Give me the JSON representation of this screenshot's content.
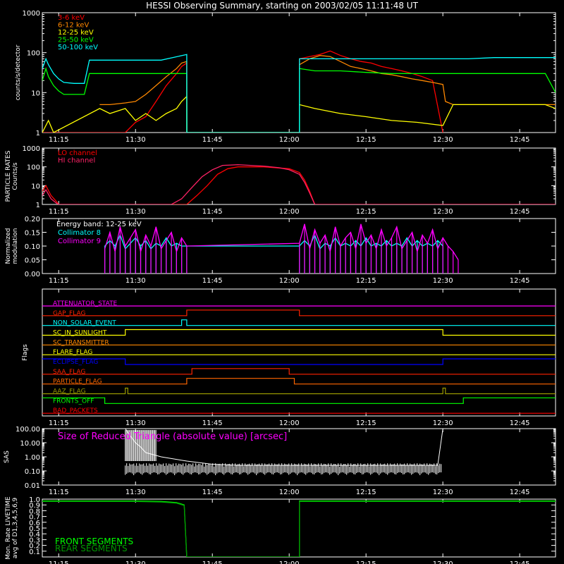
{
  "title": "HESSI Observing Summary, starting on 2003/02/05 11:11:48 UT",
  "time_axis": {
    "range_minutes": [
      "11:11:48",
      "12:53"
    ],
    "tick_labels": [
      "11:15",
      "11:30",
      "11:45",
      "12:00",
      "12:15",
      "12:30",
      "12:45"
    ],
    "tick_minutes": [
      675,
      690,
      705,
      720,
      735,
      750,
      765
    ]
  },
  "chart_data": [
    {
      "type": "line",
      "ylabel": "counts/s/detector",
      "yscale": "log",
      "ylim": [
        1,
        1000
      ],
      "ytick_labels": [
        "1",
        "10",
        "100",
        "1000"
      ],
      "ytick_values": [
        1,
        10,
        100,
        1000
      ],
      "legend": "top-left",
      "series": [
        {
          "name": "3-6 keV",
          "color": "#ff0000",
          "x": [
            671.8,
            673,
            674,
            675,
            677,
            680,
            682,
            684,
            688,
            690,
            692,
            694,
            696,
            698,
            699,
            700,
            700.01,
            722,
            722.01,
            724,
            726,
            728,
            730,
            732,
            734,
            736,
            738,
            740,
            742,
            744,
            746,
            748,
            750
          ],
          "y": [
            1,
            1,
            1,
            1,
            1,
            1,
            1,
            1,
            1,
            1.8,
            2.5,
            6,
            15,
            30,
            45,
            55,
            1,
            1,
            70,
            80,
            90,
            110,
            85,
            70,
            60,
            55,
            45,
            40,
            35,
            30,
            25,
            20,
            1
          ]
        },
        {
          "name": "6-12 keV",
          "color": "#ff8800",
          "x": [
            683,
            685,
            688,
            690,
            692,
            694,
            696,
            698,
            699,
            700,
            700.01,
            722,
            722.01,
            724,
            726,
            728,
            730,
            732,
            734,
            736,
            738,
            740,
            742,
            744,
            746,
            748,
            750,
            750.5,
            752,
            755,
            760,
            765,
            772
          ],
          "y": [
            5,
            5,
            5.5,
            6,
            9,
            15,
            25,
            40,
            55,
            60,
            1,
            1,
            50,
            70,
            85,
            80,
            60,
            45,
            40,
            35,
            30,
            28,
            25,
            22,
            20,
            18,
            16,
            6,
            5,
            5,
            5,
            5,
            5
          ]
        },
        {
          "name": "12-25 keV",
          "color": "#ffff00",
          "x": [
            671.8,
            673,
            674,
            683,
            685,
            688,
            690,
            692,
            694,
            696,
            698,
            699,
            700,
            700.01,
            722,
            722.01,
            725,
            730,
            735,
            740,
            745,
            750,
            752,
            755,
            760,
            765,
            770,
            772
          ],
          "y": [
            1,
            2,
            1,
            4,
            3,
            4,
            2,
            3,
            2,
            3,
            4,
            6,
            8,
            1,
            1,
            5,
            4,
            3,
            2.5,
            2,
            1.8,
            1.5,
            5,
            5,
            5,
            5,
            5,
            4
          ]
        },
        {
          "name": "25-50 keV",
          "color": "#00ff00",
          "x": [
            671.8,
            672.5,
            673,
            674,
            675,
            676,
            677,
            679,
            680,
            681,
            685,
            690,
            695,
            700,
            700.01,
            722,
            722.01,
            725,
            730,
            735,
            740,
            745,
            750,
            755,
            760,
            765,
            770,
            772
          ],
          "y": [
            20,
            40,
            25,
            15,
            11,
            9,
            9,
            9,
            9,
            30,
            30,
            30,
            30,
            30,
            1,
            1,
            40,
            35,
            35,
            32,
            30,
            30,
            30,
            30,
            30,
            30,
            30,
            10
          ]
        },
        {
          "name": "50-100 keV",
          "color": "#00ffff",
          "x": [
            671.8,
            672.5,
            673,
            674,
            675,
            676,
            678,
            680,
            681,
            685,
            690,
            695,
            700,
            700.01,
            722,
            722.01,
            725,
            730,
            735,
            740,
            745,
            750,
            755,
            760,
            765,
            770,
            772
          ],
          "y": [
            40,
            70,
            50,
            30,
            22,
            18,
            17,
            17,
            65,
            65,
            65,
            65,
            90,
            1,
            1,
            70,
            70,
            70,
            70,
            70,
            70,
            70,
            70,
            75,
            75,
            75,
            75
          ]
        }
      ]
    },
    {
      "type": "line",
      "ylabel": "PARTICLE RATES Counts/s",
      "yscale": "log",
      "ylim": [
        1,
        1000
      ],
      "ytick_labels": [
        "1",
        "10",
        "100",
        "1000"
      ],
      "ytick_values": [
        1,
        10,
        100,
        1000
      ],
      "legend": "top-left",
      "series": [
        {
          "name": "LO channel",
          "color": "#ff0000",
          "x": [
            671.8,
            672.5,
            673.5,
            674.5,
            675,
            700,
            702,
            704,
            706,
            708,
            710,
            715,
            720,
            722,
            723,
            724,
            725,
            772
          ],
          "y": [
            5,
            10,
            3,
            1.5,
            1,
            1,
            3,
            10,
            40,
            80,
            100,
            100,
            80,
            50,
            20,
            5,
            1,
            1
          ]
        },
        {
          "name": "HI channel",
          "color": "#ff2266",
          "x": [
            671.8,
            672.5,
            673.5,
            674.5,
            675,
            697,
            699,
            701,
            703,
            705,
            707,
            710,
            715,
            718,
            720,
            722,
            723,
            724,
            725,
            772
          ],
          "y": [
            3,
            6,
            2,
            1.2,
            1,
            1,
            2,
            8,
            30,
            70,
            120,
            130,
            110,
            90,
            70,
            40,
            15,
            4,
            1,
            1
          ]
        }
      ]
    },
    {
      "type": "line",
      "ylabel": "Normalized modulation",
      "ylim": [
        0,
        0.2
      ],
      "ytick_labels": [
        "0.00",
        "0.05",
        "0.10",
        "0.15",
        "0.20"
      ],
      "ytick_values": [
        0,
        0.05,
        0.1,
        0.15,
        0.2
      ],
      "annotation": "Energy band: 12-25 keV",
      "legend": "top-left",
      "series": [
        {
          "name": "Collimator 8",
          "color": "#00ffff",
          "x": [
            684,
            685,
            686,
            687,
            688,
            689,
            690,
            691,
            692,
            693,
            694,
            695,
            696,
            697,
            698,
            699,
            700,
            722,
            723,
            724,
            725,
            726,
            727,
            728,
            729,
            730,
            731,
            732,
            733,
            734,
            735,
            736,
            737,
            738,
            739,
            740,
            741,
            742,
            743,
            744,
            745,
            746,
            747,
            748,
            749,
            750
          ],
          "y": [
            0.1,
            0.12,
            0.1,
            0.14,
            0.09,
            0.11,
            0.13,
            0.1,
            0.12,
            0.09,
            0.11,
            0.1,
            0.13,
            0.1,
            0.11,
            0.1,
            0.1,
            0.1,
            0.12,
            0.1,
            0.14,
            0.09,
            0.11,
            0.1,
            0.13,
            0.1,
            0.11,
            0.1,
            0.12,
            0.1,
            0.13,
            0.1,
            0.11,
            0.1,
            0.12,
            0.1,
            0.11,
            0.1,
            0.13,
            0.1,
            0.12,
            0.1,
            0.11,
            0.1,
            0.12,
            0.1
          ]
        },
        {
          "name": "Collimator 9",
          "color": "#ff00ff",
          "x": [
            684,
            685,
            686,
            687,
            688,
            689,
            690,
            691,
            692,
            693,
            694,
            695,
            696,
            697,
            698,
            699,
            700,
            722,
            723,
            724,
            725,
            726,
            727,
            728,
            729,
            730,
            731,
            732,
            733,
            734,
            735,
            736,
            737,
            738,
            739,
            740,
            741,
            742,
            743,
            744,
            745,
            746,
            747,
            748,
            749,
            750,
            751,
            752,
            753
          ],
          "y": [
            0.09,
            0.15,
            0.08,
            0.17,
            0.1,
            0.13,
            0.16,
            0.08,
            0.14,
            0.1,
            0.17,
            0.09,
            0.12,
            0.15,
            0.08,
            0.13,
            0.1,
            0.11,
            0.18,
            0.09,
            0.16,
            0.11,
            0.14,
            0.08,
            0.17,
            0.1,
            0.13,
            0.15,
            0.09,
            0.18,
            0.11,
            0.14,
            0.09,
            0.16,
            0.1,
            0.13,
            0.17,
            0.09,
            0.12,
            0.15,
            0.08,
            0.14,
            0.11,
            0.16,
            0.09,
            0.13,
            0.1,
            0.08,
            0.05
          ]
        }
      ]
    },
    {
      "type": "line",
      "ylabel": "Flags",
      "series": [
        {
          "name": "ATTENUATOR_STATE",
          "color": "#ff00ff",
          "x": [
            671.8,
            772
          ],
          "y": [
            0,
            0
          ]
        },
        {
          "name": "GAP_FLAG",
          "color": "#ff2200",
          "x": [
            671.8,
            700,
            700,
            722,
            722,
            772
          ],
          "y": [
            0,
            0,
            1,
            1,
            0,
            0
          ]
        },
        {
          "name": "NON_SOLAR_EVENT",
          "color": "#00ffff",
          "x": [
            671.8,
            699,
            699,
            700,
            700,
            772
          ],
          "y": [
            0,
            0,
            1,
            1,
            0,
            0
          ]
        },
        {
          "name": "SC_IN_SUNLIGHT",
          "color": "#ffff00",
          "x": [
            671.8,
            688,
            688,
            750,
            750,
            772
          ],
          "y": [
            0,
            0,
            1,
            1,
            0,
            0
          ]
        },
        {
          "name": "SC_TRANSMITTER",
          "color": "#ff8800",
          "x": [
            671.8,
            772
          ],
          "y": [
            0,
            0
          ]
        },
        {
          "name": "FLARE_FLAG",
          "color": "#ffff00",
          "x": [
            671.8,
            772
          ],
          "y": [
            0,
            0
          ]
        },
        {
          "name": "ECLIPSE_FLAG",
          "color": "#0000ff",
          "x": [
            671.8,
            688,
            688,
            750,
            750,
            772
          ],
          "y": [
            1,
            1,
            0,
            0,
            1,
            1
          ]
        },
        {
          "name": "SAA_FLAG",
          "color": "#ff2200",
          "x": [
            671.8,
            701,
            701,
            720,
            720,
            772
          ],
          "y": [
            0,
            0,
            1,
            1,
            0,
            0
          ]
        },
        {
          "name": "PARTICLE_FLAG",
          "color": "#ff6600",
          "x": [
            671.8,
            700,
            700,
            721,
            721,
            772
          ],
          "y": [
            0,
            0,
            1,
            1,
            0,
            0
          ]
        },
        {
          "name": "AAZ_FLAG",
          "color": "#999900",
          "x": [
            671.8,
            688,
            688,
            688.5,
            688.5,
            750,
            750,
            750.5,
            750.5,
            772
          ],
          "y": [
            0,
            0,
            1,
            1,
            0,
            0,
            1,
            1,
            0,
            0
          ]
        },
        {
          "name": "FRONTS_OFF",
          "color": "#00ff00",
          "x": [
            671.8,
            684,
            684,
            754,
            754,
            772
          ],
          "y": [
            1,
            1,
            0,
            0,
            1,
            1
          ]
        },
        {
          "name": "BAD_PACKETS",
          "color": "#ff0000",
          "x": [
            671.8,
            772
          ],
          "y": [
            0,
            0
          ]
        }
      ]
    },
    {
      "type": "line",
      "ylabel": "SAS",
      "yscale": "log",
      "ylim": [
        0.01,
        100
      ],
      "ytick_labels": [
        "0.01",
        "0.10",
        "1.00",
        "10.00",
        "100.00"
      ],
      "ytick_values": [
        0.01,
        0.1,
        1,
        10,
        100
      ],
      "annotation": "Size of Reduced Triangle (absolute value) [arcsec]",
      "series": [
        {
          "name": "Size of Reduced Triangle",
          "color": "#ffffff",
          "x": [
            688,
            689,
            690,
            691,
            692,
            695,
            700,
            705,
            710,
            715,
            720,
            725,
            730,
            735,
            740,
            745,
            749,
            750
          ],
          "y": [
            100,
            30,
            10,
            5,
            2,
            1,
            0.5,
            0.3,
            0.25,
            0.25,
            0.25,
            0.25,
            0.25,
            0.25,
            0.25,
            0.25,
            0.25,
            100
          ]
        }
      ]
    },
    {
      "type": "line",
      "ylabel": "Mon. Rate LIVETIME avg of D1,3,4,5,6,9",
      "ylim": [
        0,
        1
      ],
      "ytick_labels": [
        "0.1",
        "0.2",
        "0.3",
        "0.4",
        "0.5",
        "0.6",
        "0.7",
        "0.8",
        "0.9",
        "1.0"
      ],
      "ytick_values": [
        0.1,
        0.2,
        0.3,
        0.4,
        0.5,
        0.6,
        0.7,
        0.8,
        0.9,
        1.0
      ],
      "legend": "bottom-left",
      "series": [
        {
          "name": "FRONT SEGMENTS",
          "color": "#00ff00",
          "x": [
            671.8,
            680,
            690,
            695,
            698,
            699.5,
            700,
            700.01,
            722,
            722.01,
            730,
            740,
            750,
            760,
            772
          ],
          "y": [
            0.97,
            0.97,
            0.97,
            0.96,
            0.94,
            0.9,
            0.0,
            0.0,
            0.0,
            0.97,
            0.97,
            0.97,
            0.97,
            0.97,
            0.97
          ]
        },
        {
          "name": "REAR SEGMENTS",
          "color": "#009900",
          "x": [
            671.8,
            680,
            690,
            695,
            698,
            699.5,
            700,
            700.01,
            722,
            722.01,
            730,
            740,
            750,
            760,
            772
          ],
          "y": [
            0.96,
            0.96,
            0.96,
            0.95,
            0.93,
            0.89,
            0.0,
            0.0,
            0.0,
            0.96,
            0.96,
            0.96,
            0.96,
            0.96,
            0.96
          ]
        }
      ]
    }
  ]
}
